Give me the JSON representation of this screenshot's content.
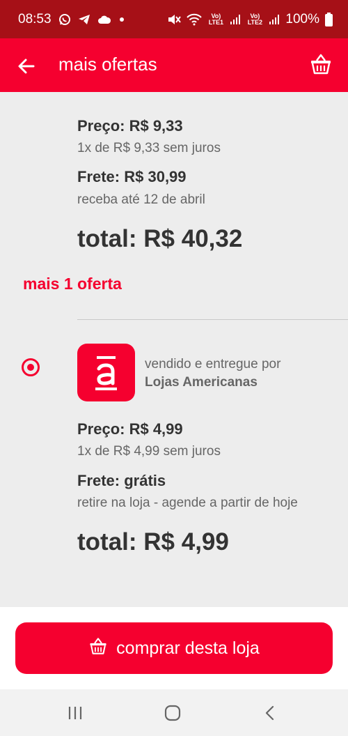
{
  "status_bar": {
    "time": "08:53",
    "battery": "100%",
    "sim1_label": "Vo) LTE1",
    "sim2_label": "Vo) LTE2",
    "icons": [
      "whatsapp-icon",
      "telegram-icon",
      "cloud-icon",
      "dot-icon",
      "mute-icon",
      "wifi-icon",
      "signal-icon",
      "battery-icon"
    ]
  },
  "app_bar": {
    "title": "mais ofertas"
  },
  "offer1": {
    "price_label": "Preço: R$ 9,33",
    "installments": "1x de R$ 9,33 sem juros",
    "shipping_label": "Frete: R$ 30,99",
    "delivery": "receba até 12 de abril",
    "total": "total: R$ 40,32"
  },
  "more_offers": "mais 1 oferta",
  "offer2": {
    "sold_by": "vendido e entregue por",
    "store": "Lojas Americanas",
    "price_label": "Preço: R$ 4,99",
    "installments": "1x de R$ 4,99 sem juros",
    "shipping_label": "Frete: grátis",
    "delivery": "retire na loja - agende a partir de hoje",
    "total": "total: R$ 4,99"
  },
  "buy_button": {
    "label": "comprar desta loja"
  },
  "colors": {
    "brand": "#f5002f",
    "status_bar": "#a61017",
    "background": "#ededed"
  }
}
